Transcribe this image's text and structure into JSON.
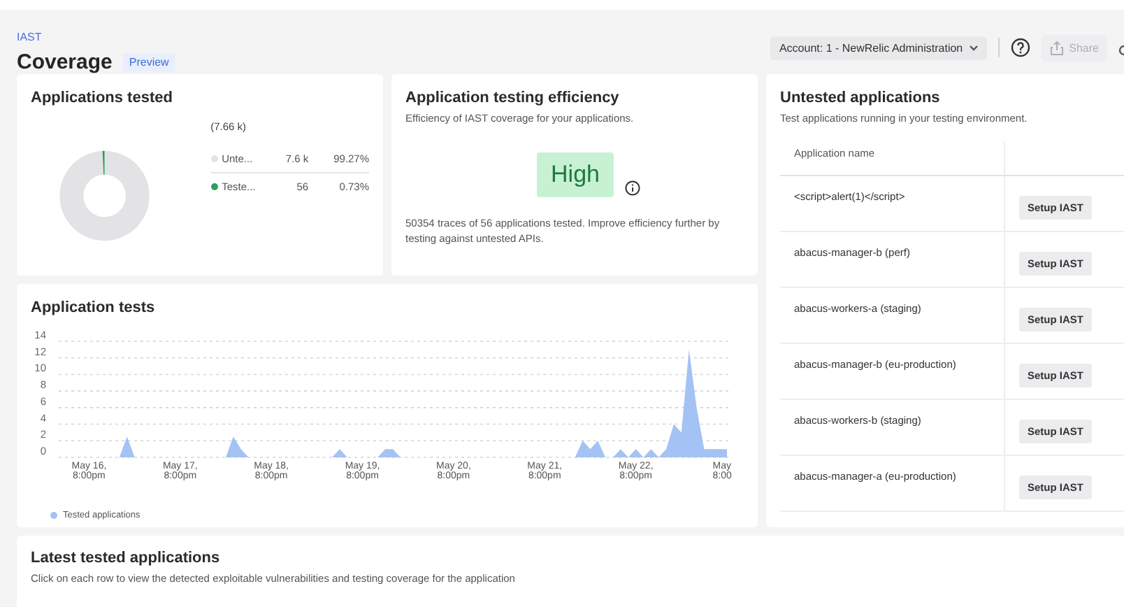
{
  "breadcrumb": "IAST",
  "title": "Coverage",
  "badge": "Preview",
  "header_actions": {
    "account": "Account: 1 - NewRelic Administration",
    "share": "Share",
    "share_disabled": true
  },
  "applications_tested": {
    "title": "Applications tested",
    "total": "(7.66 k)",
    "legend": [
      {
        "label": "Unte...",
        "count": "7.6 k",
        "percent": "99.27%",
        "color": "#e3e3e5"
      },
      {
        "label": "Teste...",
        "count": "56",
        "percent": "0.73%",
        "color": "#2e9e5b"
      }
    ],
    "chart_data": {
      "type": "donut",
      "values": [
        99.27,
        0.73
      ]
    }
  },
  "efficiency": {
    "title": "Application testing efficiency",
    "subtitle": "Efficiency of IAST coverage for your applications.",
    "rating": "High",
    "description": "50354 traces of 56 applications tested. Improve efficiency further by testing against untested APIs."
  },
  "application_tests": {
    "title": "Application tests",
    "chart_data": {
      "type": "area",
      "grid": true,
      "ylim": [
        0,
        14
      ],
      "yticks": [
        0,
        2,
        4,
        6,
        8,
        10,
        12,
        14
      ],
      "categories": [
        null,
        null,
        null,
        null,
        "May 16,\n8:00pm",
        null,
        null,
        null,
        null,
        null,
        null,
        null,
        null,
        null,
        null,
        null,
        "May 17,\n8:00pm",
        null,
        null,
        null,
        null,
        null,
        null,
        null,
        null,
        null,
        null,
        null,
        "May 18,\n8:00pm",
        null,
        null,
        null,
        null,
        null,
        null,
        null,
        null,
        null,
        null,
        null,
        "May 19,\n8:00pm",
        null,
        null,
        null,
        null,
        null,
        null,
        null,
        null,
        null,
        null,
        null,
        "May 20,\n8:00pm",
        null,
        null,
        null,
        null,
        null,
        null,
        null,
        null,
        null,
        null,
        null,
        "May 21,\n8:00pm",
        null,
        null,
        null,
        null,
        null,
        null,
        null,
        null,
        null,
        null,
        null,
        "May 22,\n8:00pm",
        null,
        null,
        null,
        null,
        null,
        null,
        null,
        null,
        null,
        null,
        null,
        "May\n8:00"
      ],
      "series": [
        {
          "name": "Tested applications",
          "color": "#a4c2f4",
          "values": [
            0,
            0,
            0,
            0,
            0,
            0,
            0,
            0,
            0,
            2.5,
            0,
            0,
            0,
            0,
            0,
            0,
            0,
            0,
            0,
            0,
            0,
            0,
            0,
            2.5,
            1,
            0,
            0,
            0,
            0,
            0,
            0,
            0,
            0,
            0,
            0,
            0,
            0,
            1,
            0,
            0,
            0,
            0,
            0,
            1,
            1,
            0,
            0,
            0,
            0,
            0,
            0,
            0,
            0,
            0,
            0,
            0,
            0,
            0,
            0,
            0,
            0,
            0,
            0,
            0,
            0,
            0,
            0,
            0,
            0,
            2,
            1,
            2,
            0,
            0,
            1,
            0,
            1,
            0,
            1,
            0,
            1,
            4,
            3,
            13,
            6,
            1,
            1,
            1,
            1
          ]
        }
      ]
    }
  },
  "untested": {
    "title": "Untested applications",
    "subtitle": "Test applications running in your testing environment.",
    "column": "Application name",
    "rows": [
      {
        "name": "<script>alert(1)</script>",
        "action": "Setup IAST"
      },
      {
        "name": "abacus-manager-b (perf)",
        "action": "Setup IAST"
      },
      {
        "name": "abacus-workers-a (staging)",
        "action": "Setup IAST"
      },
      {
        "name": "abacus-manager-b (eu-production)",
        "action": "Setup IAST"
      },
      {
        "name": "abacus-workers-b (staging)",
        "action": "Setup IAST"
      },
      {
        "name": "abacus-manager-a (eu-production)",
        "action": "Setup IAST"
      }
    ]
  },
  "latest": {
    "title": "Latest tested applications",
    "subtitle": "Click on each row to view the detected exploitable vulnerabilities and testing coverage for the application"
  }
}
